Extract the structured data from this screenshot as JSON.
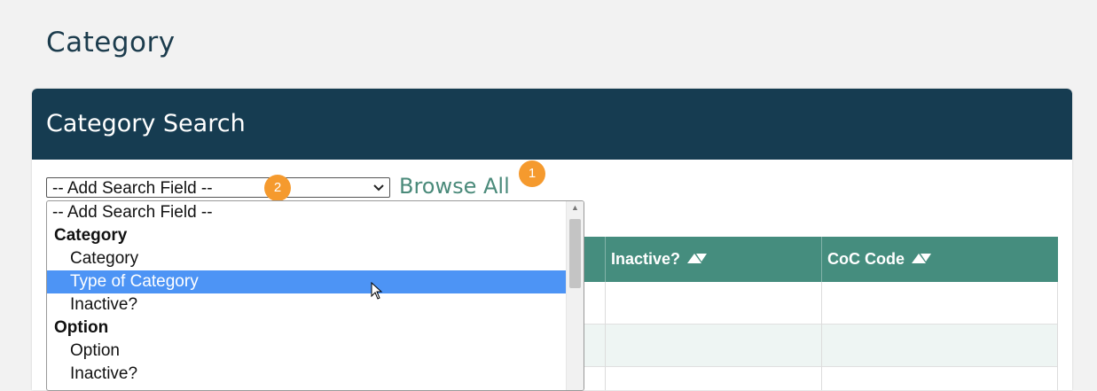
{
  "page": {
    "title": "Category"
  },
  "panel": {
    "title": "Category Search"
  },
  "search": {
    "selected_value": "-- Add Search Field --",
    "browse_all_label": "Browse All"
  },
  "badges": {
    "one": "1",
    "two": "2"
  },
  "table": {
    "headers": [
      "Inactive?",
      "CoC Code"
    ]
  },
  "dropdown": {
    "options": [
      "-- Add Search Field --",
      "Category",
      "Category",
      "Type of Category",
      "Inactive?",
      "Option",
      "Option",
      "Inactive?"
    ]
  },
  "colors": {
    "header_bg": "#163c51",
    "table_header_bg": "#458d7e",
    "accent_link": "#4a8a7a",
    "badge": "#f59a2e",
    "selected_option": "#4d94f5"
  },
  "icons": {
    "sort": "sort-triangle-icon",
    "chevron": "chevron-down-icon",
    "cursor": "mouse-pointer-icon"
  }
}
